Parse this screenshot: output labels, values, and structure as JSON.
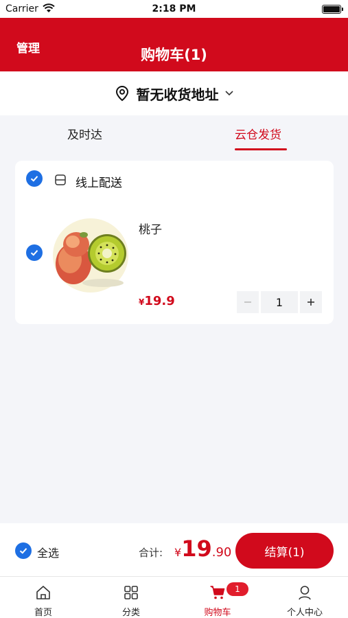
{
  "status_bar": {
    "carrier": "Carrier",
    "time": "2:18 PM"
  },
  "header": {
    "manage_label": "管理",
    "title": "购物车(1)",
    "bg_color": "#d10a1c"
  },
  "address": {
    "text": "暂无收货地址",
    "icon": "location-pin-icon"
  },
  "tabs": [
    {
      "label": "及时达",
      "active": false
    },
    {
      "label": "云仓发货",
      "active": true
    }
  ],
  "cart_group": {
    "label": "线上配送",
    "checked": true,
    "items": [
      {
        "name": "桃子",
        "price_currency": "¥",
        "price": "19.9",
        "quantity": "1",
        "checked": true
      }
    ]
  },
  "checkout": {
    "select_all_label": "全选",
    "total_label": "合计:",
    "total_currency": "¥",
    "total_integer": "19",
    "total_decimal": ".90",
    "button_label": "结算(1)"
  },
  "tabbar": {
    "items": [
      {
        "label": "首页",
        "icon": "home-icon",
        "active": false
      },
      {
        "label": "分类",
        "icon": "category-grid-icon",
        "active": false
      },
      {
        "label": "购物车",
        "icon": "cart-icon",
        "active": true,
        "badge": "1"
      },
      {
        "label": "个人中心",
        "icon": "user-icon",
        "active": false
      }
    ]
  }
}
